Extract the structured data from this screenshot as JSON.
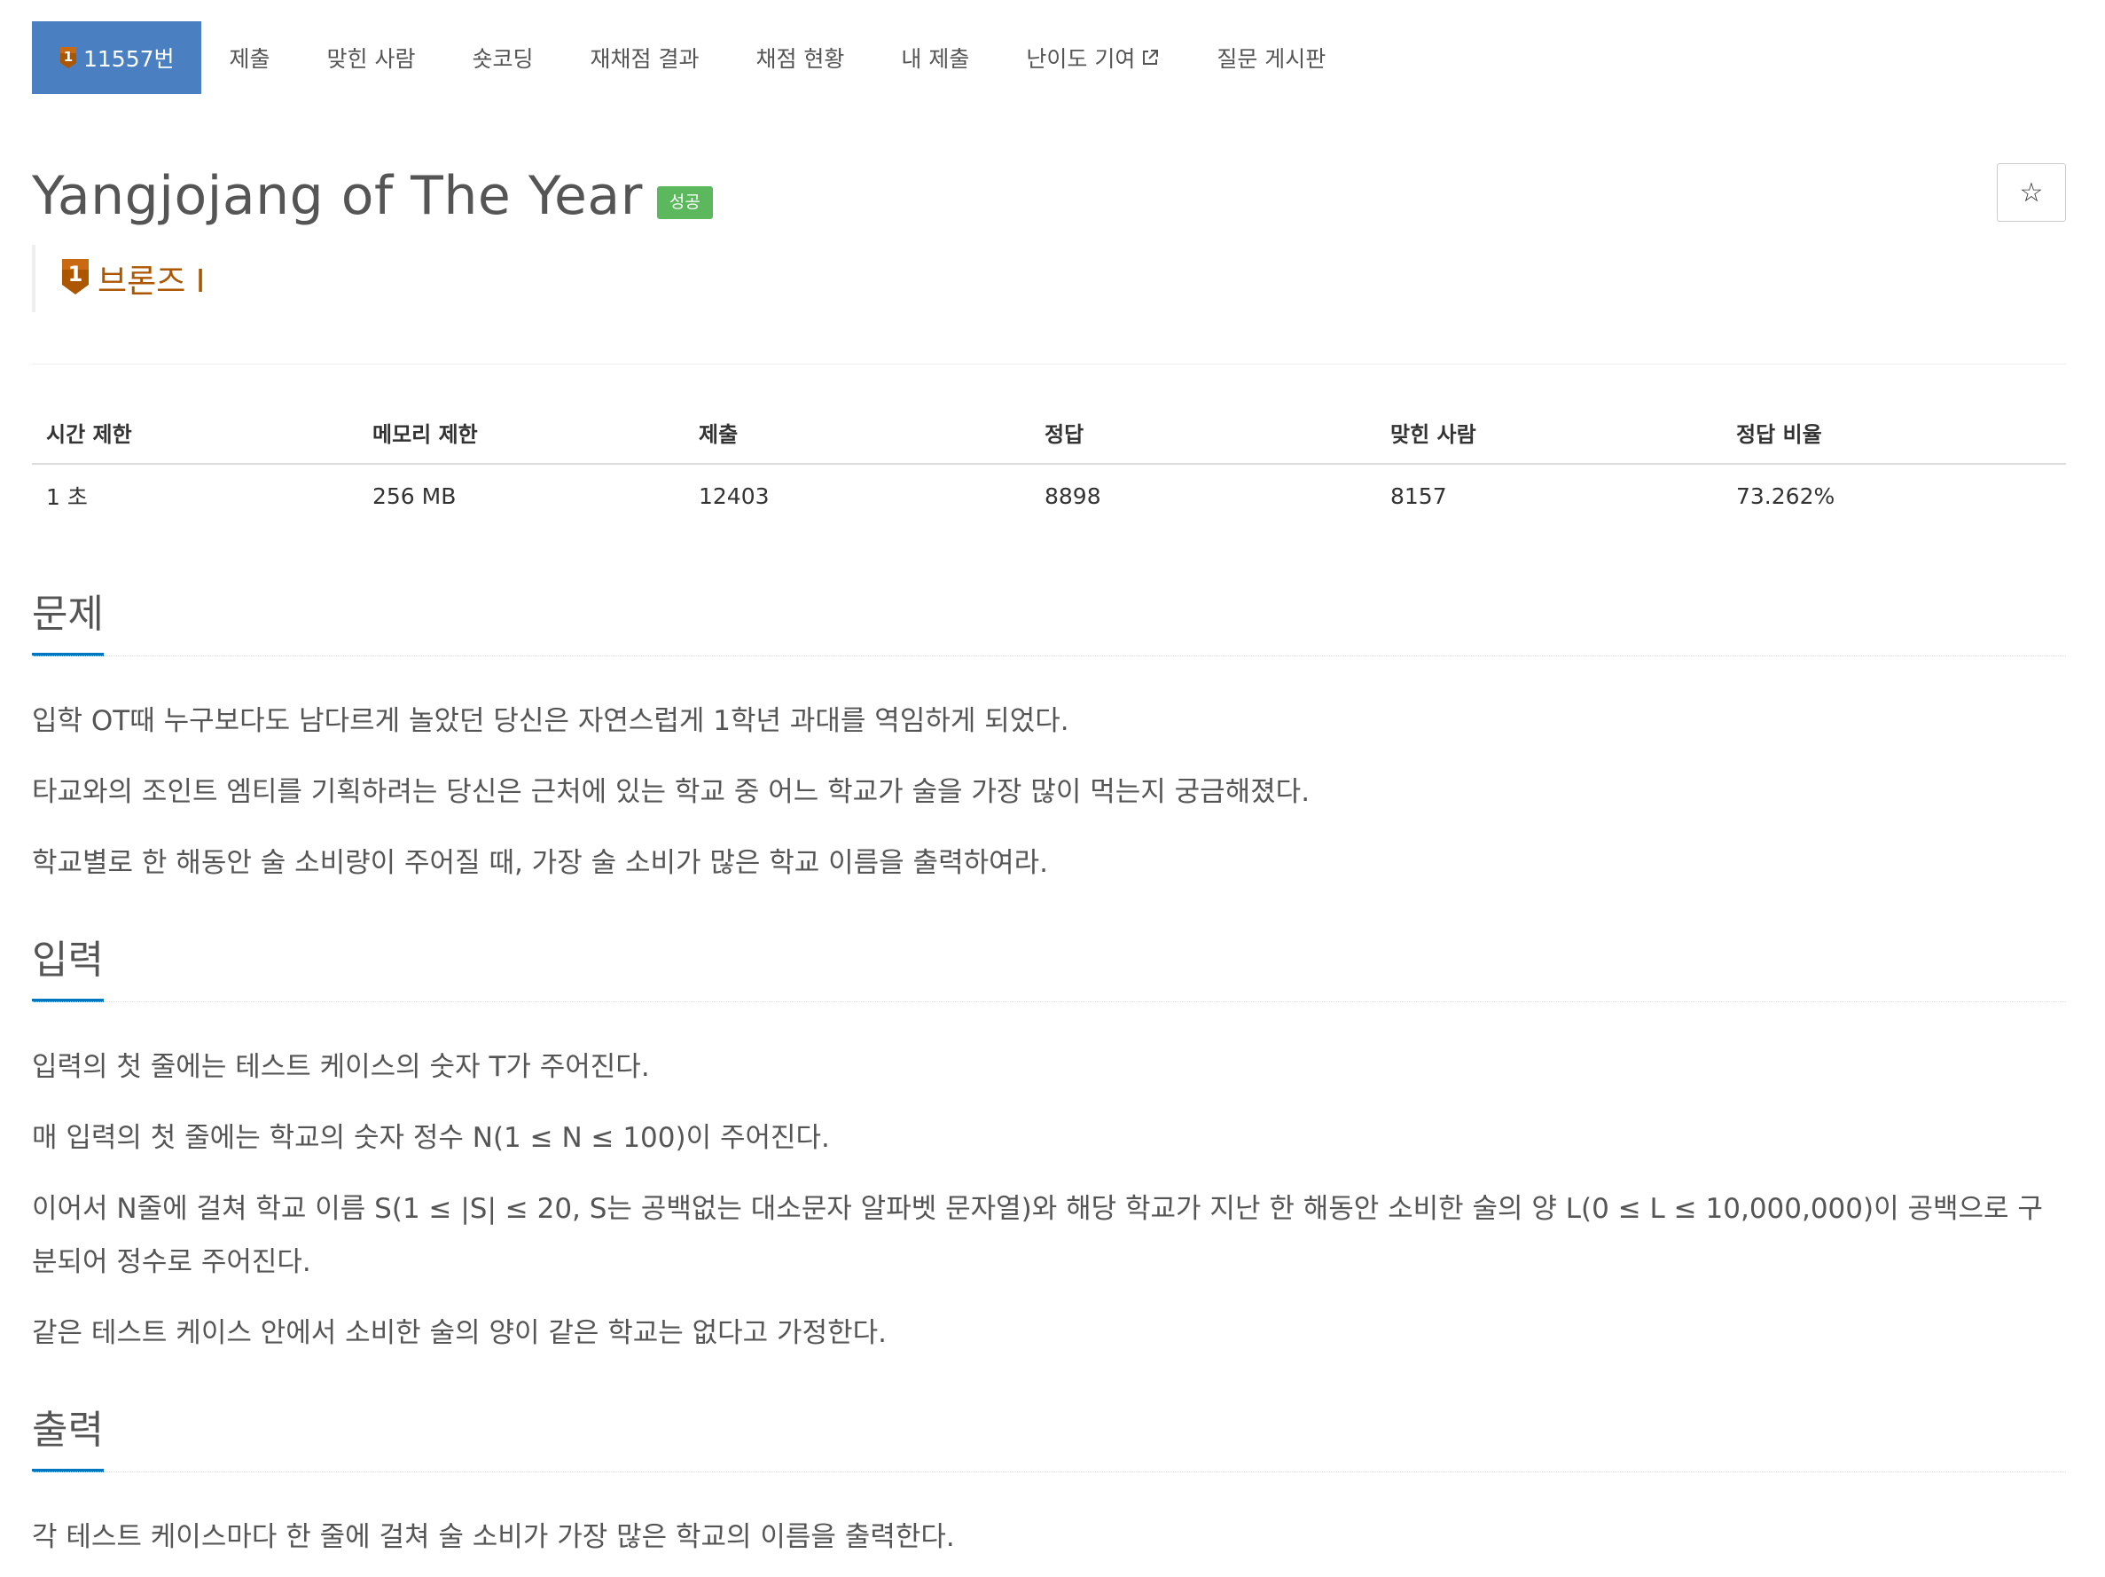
{
  "colors": {
    "tab_active": "#4a7fc1",
    "bronze": "#ad5600",
    "success": "#5cb85c",
    "section_underline": "#0076c0"
  },
  "tabs": [
    {
      "label": "11557번",
      "active": true,
      "icon": "bronze-tier-icon"
    },
    {
      "label": "제출"
    },
    {
      "label": "맞힌 사람"
    },
    {
      "label": "숏코딩"
    },
    {
      "label": "재채점 결과"
    },
    {
      "label": "채점 현황"
    },
    {
      "label": "내 제출"
    },
    {
      "label": "난이도 기여",
      "icon": "external-link-icon"
    },
    {
      "label": "질문 게시판"
    }
  ],
  "problem": {
    "title": "Yangjojang of The Year",
    "status_label": "성공",
    "tier_level": "1",
    "tier": "브론즈 I",
    "star_icon": "☆"
  },
  "info": {
    "headers": [
      "시간 제한",
      "메모리 제한",
      "제출",
      "정답",
      "맞힌 사람",
      "정답 비율"
    ],
    "values": [
      "1 초",
      "256 MB",
      "12403",
      "8898",
      "8157",
      "73.262%"
    ]
  },
  "sections": {
    "problem": {
      "title": "문제",
      "lines": [
        "입학 OT때 누구보다도 남다르게 놀았던 당신은 자연스럽게 1학년 과대를 역임하게 되었다.",
        "타교와의 조인트 엠티를 기획하려는 당신은 근처에 있는 학교 중 어느 학교가 술을 가장 많이 먹는지 궁금해졌다.",
        "학교별로 한 해동안 술 소비량이 주어질 때, 가장 술 소비가 많은 학교 이름을 출력하여라."
      ]
    },
    "input": {
      "title": "입력",
      "lines": [
        "입력의 첫 줄에는 테스트 케이스의 숫자 T가 주어진다.",
        "매 입력의 첫 줄에는 학교의 숫자 정수 N(1 ≤ N ≤ 100)이 주어진다.",
        "이어서 N줄에 걸쳐 학교 이름 S(1 ≤ |S| ≤ 20, S는 공백없는 대소문자 알파벳 문자열)와 해당 학교가 지난 한 해동안 소비한 술의 양 L(0 ≤ L ≤ 10,000,000)이 공백으로 구분되어 정수로 주어진다.",
        "같은 테스트 케이스 안에서 소비한 술의 양이 같은 학교는 없다고 가정한다."
      ]
    },
    "output": {
      "title": "출력",
      "lines": [
        "각 테스트 케이스마다 한 줄에 걸쳐 술 소비가 가장 많은 학교의 이름을 출력한다."
      ]
    }
  }
}
